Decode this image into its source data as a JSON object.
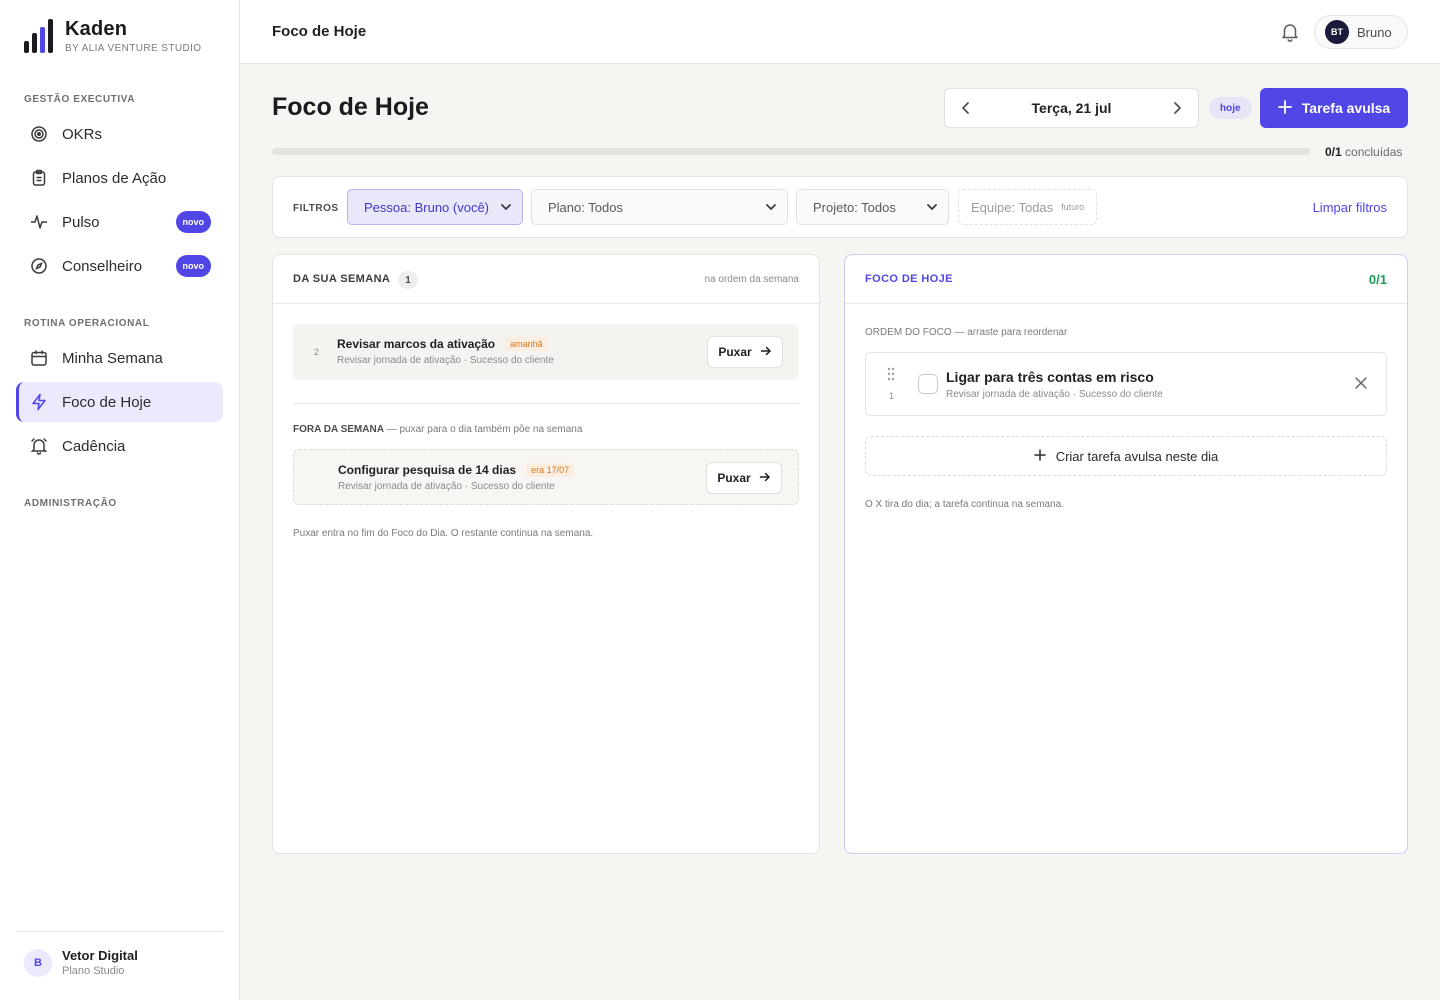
{
  "brand": {
    "name": "Kaden",
    "sub": "BY ALIA VENTURE STUDIO"
  },
  "nav": {
    "section_exec": "GESTÃO EXECUTIVA",
    "okrs": "OKRs",
    "planos": "Planos de Ação",
    "pulso": "Pulso",
    "conselheiro": "Conselheiro",
    "badge_novo": "novo",
    "section_rotina": "ROTINA OPERACIONAL",
    "minha_semana": "Minha Semana",
    "foco_hoje": "Foco de Hoje",
    "cadencia": "Cadência",
    "section_admin": "ADMINISTRAÇÃO"
  },
  "workspace": {
    "avatar": "B",
    "name": "Vetor Digital",
    "plan": "Plano Studio"
  },
  "topbar": {
    "title": "Foco de Hoje",
    "user_initials": "BT",
    "user_name": "Bruno"
  },
  "header": {
    "title": "Foco de Hoje",
    "date": "Terça, 21 jul",
    "today_pill": "hoje",
    "new_task": "Tarefa avulsa"
  },
  "progress": {
    "done": "0/1",
    "label": "concluídas",
    "fraction": 0
  },
  "filters": {
    "label": "FILTROS",
    "pessoa": "Pessoa: Bruno (você)",
    "plano": "Plano: Todos",
    "projeto": "Projeto: Todos",
    "equipe": "Equipe: Todas",
    "equipe_tag": "futuro",
    "clear": "Limpar filtros"
  },
  "week_panel": {
    "title": "DA SUA SEMANA",
    "count": "1",
    "meta": "na ordem da semana",
    "tasks": [
      {
        "order": "2",
        "title": "Revisar marcos da ativação",
        "tag": "amanhã",
        "subtitle": "Revisar jornada de ativação · Sucesso do cliente",
        "action": "Puxar"
      }
    ],
    "outside_title": "FORA DA SEMANA",
    "outside_note": " — puxar para o dia também põe na semana",
    "outside_tasks": [
      {
        "title": "Configurar pesquisa de 14 dias",
        "tag": "era 17/07",
        "subtitle": "Revisar jornada de ativação · Sucesso do cliente",
        "action": "Puxar"
      }
    ],
    "footer_note": "Puxar entra no fim do Foco do Dia. O restante continua na semana."
  },
  "focus_panel": {
    "title": "FOCO DE HOJE",
    "score": "0/1",
    "order_title": "ORDEM DO FOCO",
    "order_note": " — arraste para reordenar",
    "tasks": [
      {
        "order": "1",
        "title": "Ligar para três contas em risco",
        "subtitle": "Revisar jornada de ativação · Sucesso do cliente"
      }
    ],
    "create": "Criar tarefa avulsa neste dia",
    "footer_note": "O X tira do dia; a tarefa continua na semana."
  }
}
